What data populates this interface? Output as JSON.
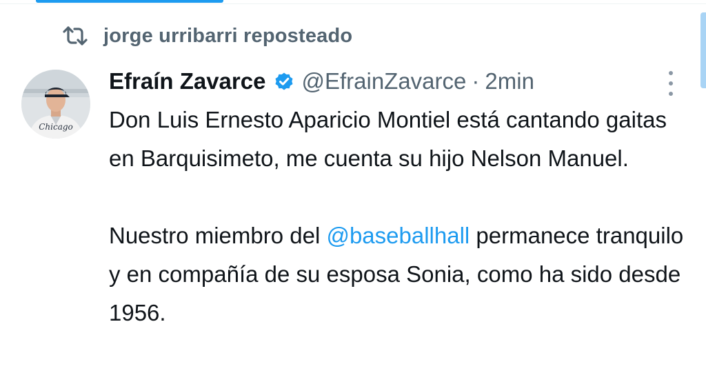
{
  "repost": {
    "icon": "repost-icon",
    "text": "jorge urribarri reposteado"
  },
  "tweet": {
    "author": {
      "display_name": "Efraín Zavarce",
      "handle": "@EfrainZavarce",
      "verified": true,
      "avatar_jersey_text": "Chicago"
    },
    "separator": "·",
    "timestamp": "2min",
    "more_icon": "more-vertical-icon",
    "paragraph_1": "Don Luis Ernesto Aparicio Montiel está cantando gaitas en Barquisimeto, me cuenta su hijo Nelson Manuel.",
    "paragraph_2_start": "Nuestro miembro del ",
    "mention": "@baseballhall",
    "paragraph_2_end": " permanece tranquilo y en compañía de su esposa Sonia, como ha sido desde 1956."
  },
  "colors": {
    "accent": "#1d9bf0",
    "secondary_text": "#536471",
    "primary_text": "#0f1419"
  }
}
